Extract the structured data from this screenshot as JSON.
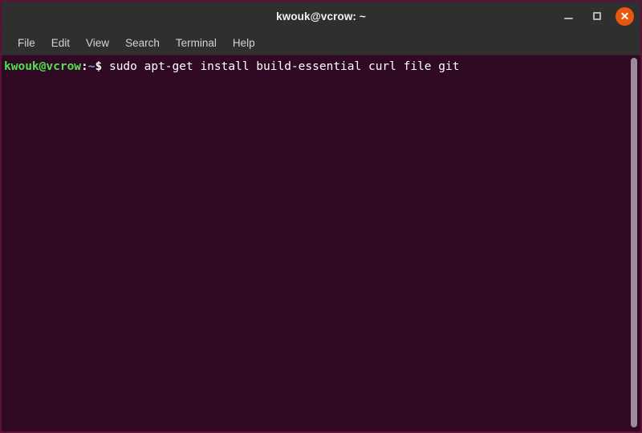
{
  "window": {
    "title": "kwouk@vcrow: ~",
    "accent_close": "#e8560f",
    "titlebar_bg": "#2f2f2f",
    "terminal_bg": "#300a24",
    "border_color": "#5c1139"
  },
  "controls": {
    "minimize_label": "Minimize",
    "maximize_label": "Maximize",
    "close_label": "Close"
  },
  "menubar": {
    "items": [
      {
        "label": "File"
      },
      {
        "label": "Edit"
      },
      {
        "label": "View"
      },
      {
        "label": "Search"
      },
      {
        "label": "Terminal"
      },
      {
        "label": "Help"
      }
    ]
  },
  "terminal": {
    "prompt": {
      "user_host": "kwouk@vcrow",
      "separator": ":",
      "path": "~",
      "sigil": "$",
      "user_host_color": "#4ee44e",
      "path_color": "#7b9fe0"
    },
    "command": " sudo apt-get install build-essential curl file git",
    "foreground": "#ffffff"
  },
  "scrollbar": {
    "thumb_color": "#a08a9c"
  }
}
